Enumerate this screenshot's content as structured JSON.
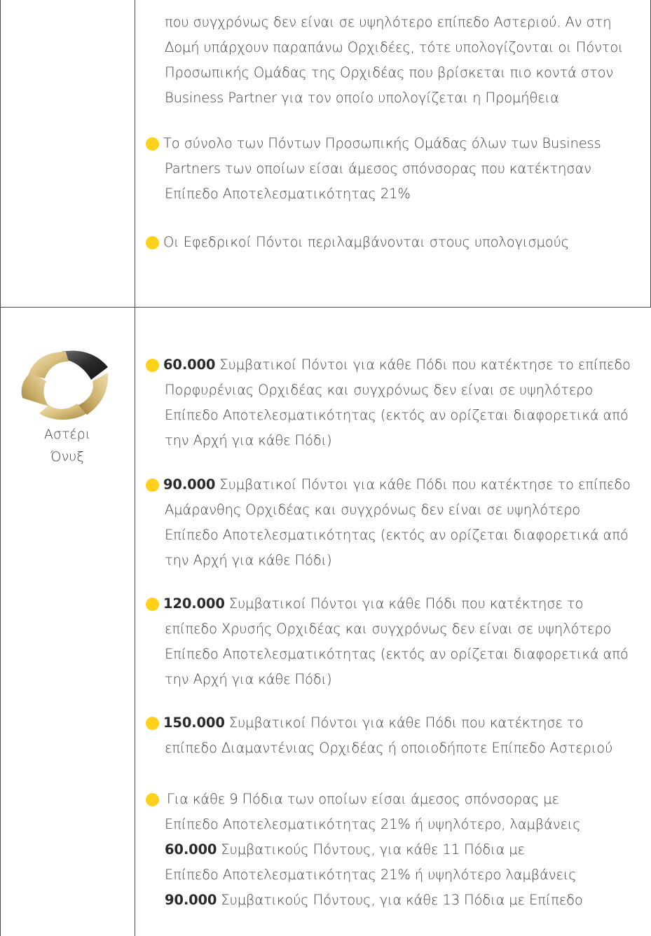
{
  "row1": {
    "continuation_lines": [
      "που συγχρόνως δεν είναι σε υψηλότερο επίπεδο Αστεριού. Αν στη",
      "Δομή υπάρχουν παραπάνω Ορχιδέες, τότε υπολογίζονται οι Πόντοι",
      "Προσωπικής Ομάδας της Ορχιδέας που  βρίσκεται πιο κοντά στον",
      "Business Partner για τον οποίο υπολογίζεται η Προμήθεια"
    ],
    "bullet1_lines": [
      "Το σύνολο των Πόντων Προσωπικής Ομάδας όλων των Business",
      "Partners των οποίων είσαι άμεσος σπόνσορας που κατέκτησαν",
      "Επίπεδο Αποτελεσματικότητας 21%"
    ],
    "bullet2_lines": [
      "Οι Εφεδρικοί Πόντοι περιλαμβάνονται στους υπολογισμούς"
    ]
  },
  "row2": {
    "star_label_line1": "Αστέρι",
    "star_label_line2": "Όνυξ",
    "bullets": [
      {
        "bold": "60.000",
        "first_rest": " Συμβατικοί Πόντοι για κάθε Πόδι που κατέκτησε το επίπεδο",
        "lines": [
          "Πορφυρένιας Ορχιδέας και συγχρόνως δεν είναι σε υψηλότερο",
          "Επίπεδο Αποτελεσματικότητας (εκτός αν ορίζεται διαφορετικά από",
          "την Αρχή για κάθε Πόδι)"
        ]
      },
      {
        "bold": "90.000",
        "first_rest": " Συμβατικοί Πόντοι για κάθε Πόδι που κατέκτησε το επίπεδο",
        "lines": [
          "Αμάρανθης Ορχιδέας και συγχρόνως δεν είναι σε υψηλότερο",
          "Επίπεδο Αποτελεσματικότητας (εκτός αν ορίζεται διαφορετικά από",
          "την Αρχή για κάθε Πόδι)"
        ]
      },
      {
        "bold": "120.000",
        "first_rest": " Συμβατικοί Πόντοι για κάθε Πόδι που κατέκτησε το",
        "lines": [
          "επίπεδο Χρυσής Ορχιδέας και συγχρόνως δεν είναι σε υψηλότερο",
          "Επίπεδο Αποτελεσματικότητας (εκτός αν ορίζεται διαφορετικά από",
          "την Αρχή για κάθε Πόδι)"
        ]
      },
      {
        "bold": "150.000",
        "first_rest": " Συμβατικοί Πόντοι για κάθε Πόδι που κατέκτησε το",
        "lines": [
          "επίπεδο Διαμαντένιας Ορχιδέας ή οποιοδήποτε Επίπεδο Αστεριού"
        ]
      }
    ],
    "last_bullet": {
      "line1": "Για κάθε 9 Πόδια των οποίων είσαι άμεσος σπόνσορας με",
      "line2": "Επίπεδο Αποτελεσματικότητας 21% ή υψηλότερο, λαμβάνεις",
      "line3_bold": "60.000",
      "line3_rest": " Συμβατικούς Πόντους, για κάθε 11 Πόδια με",
      "line4": "Επίπεδο Αποτελεσματικότητας 21% ή υψηλότερο λαμβάνεις",
      "line5_bold": "90.000",
      "line5_rest": " Συμβατικούς Πόντους, για κάθε 13 Πόδια με Επίπεδο"
    }
  },
  "colors": {
    "bullet": "#ffd11a",
    "grid": "#4a4a4a",
    "text": "#3a3a3a"
  }
}
